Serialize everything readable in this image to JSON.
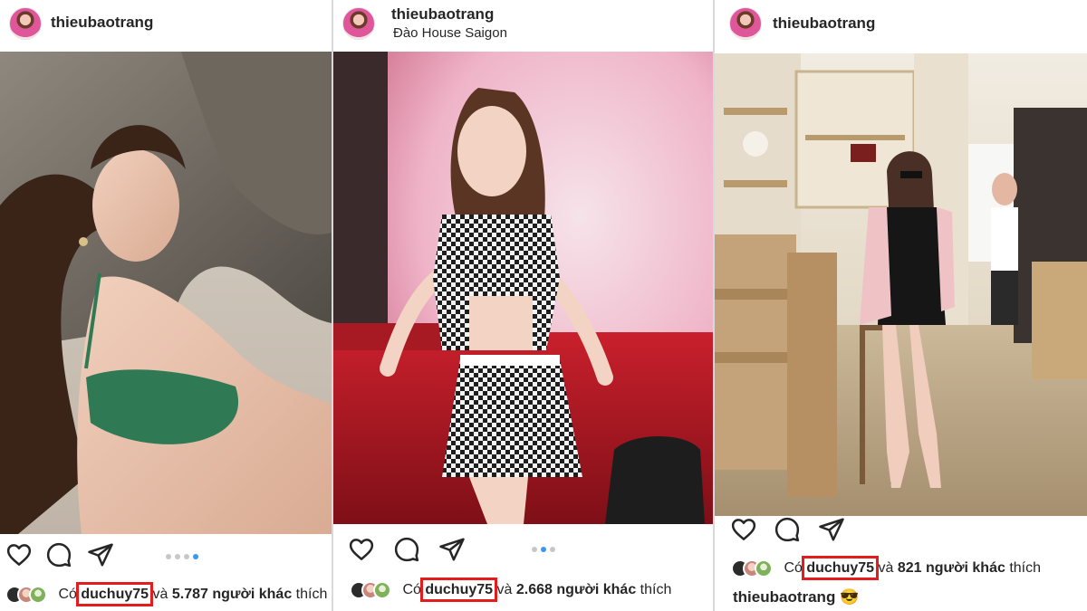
{
  "posts": [
    {
      "username": "thieubaotrang",
      "location": "",
      "carousel": {
        "count": 4,
        "active_index": 3
      },
      "likes": {
        "prefix": "Có",
        "user": "duchuy75",
        "connector": "và",
        "count_text": "5.787 người khác",
        "suffix": "thích"
      },
      "caption": {
        "username": "",
        "text": ""
      }
    },
    {
      "username": "thieubaotrang",
      "location": "Đào House Saigon",
      "carousel": {
        "count": 3,
        "active_index": 1
      },
      "likes": {
        "prefix": "Có",
        "user": "duchuy75",
        "connector": "và",
        "count_text": "2.668 người khác",
        "suffix": "thích"
      },
      "caption": {
        "username": "",
        "text": ""
      }
    },
    {
      "username": "thieubaotrang",
      "location": "",
      "carousel": {
        "count": 0,
        "active_index": 0
      },
      "likes": {
        "prefix": "Có",
        "user": "duchuy75",
        "connector": "và",
        "count_text": "821 người khác",
        "suffix": "thích"
      },
      "caption": {
        "username": "thieubaotrang",
        "text": "😎"
      }
    }
  ],
  "icons": {
    "like": "heart-icon",
    "comment": "comment-icon",
    "share": "paper-plane-icon"
  },
  "colors": {
    "highlight_box": "#e31d1d",
    "carousel_active": "#3897f0",
    "carousel_inactive": "#c7c7c7",
    "text": "#262626"
  }
}
